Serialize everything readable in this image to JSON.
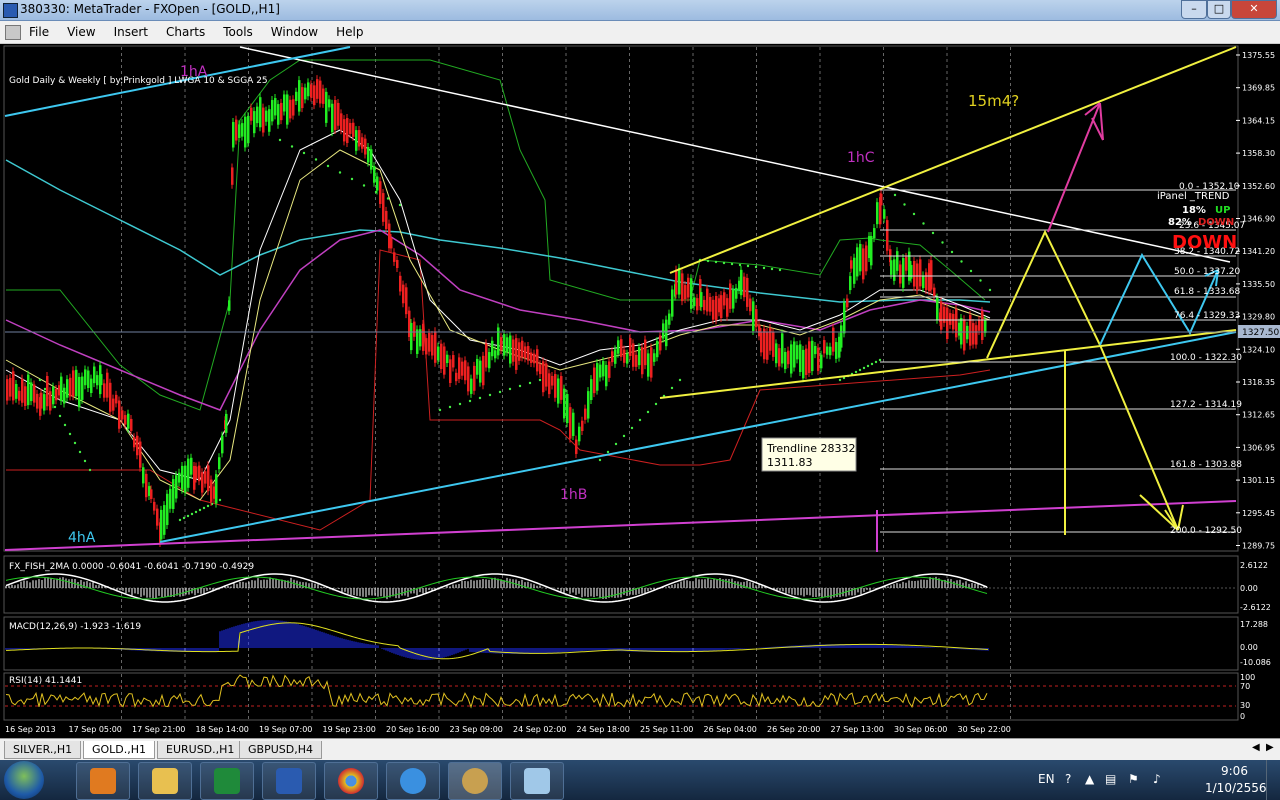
{
  "window": {
    "title": "380330: MetaTrader - FXOpen - [GOLD,,H1]"
  },
  "menu": [
    "File",
    "View",
    "Insert",
    "Charts",
    "Tools",
    "Window",
    "Help"
  ],
  "chart": {
    "header": "Gold Daily & Weekly [ by:Prinkgold ] LWGA 10  &  SGGA 25",
    "price_labels": [
      "1375.55",
      "1369.85",
      "1364.15",
      "1358.30",
      "1352.60",
      "1346.90",
      "1341.20",
      "1335.50",
      "1329.80",
      "1324.10",
      "1318.35",
      "1312.65",
      "1306.95",
      "1301.15",
      "1295.45",
      "1289.75"
    ],
    "current_price": "1327.50",
    "time_labels": [
      "16 Sep 2013",
      "17 Sep 05:00",
      "17 Sep 21:00",
      "18 Sep 14:00",
      "19 Sep 07:00",
      "19 Sep 23:00",
      "20 Sep 16:00",
      "23 Sep 09:00",
      "24 Sep 02:00",
      "24 Sep 18:00",
      "25 Sep 11:00",
      "26 Sep 04:00",
      "26 Sep 20:00",
      "27 Sep 13:00",
      "30 Sep 06:00",
      "30 Sep 22:00"
    ],
    "annotations": {
      "a1": "1hA",
      "a2": "1hB",
      "a3": "1hC",
      "a4": "4hA",
      "a5": "15m4?"
    },
    "fib_levels": [
      "0.0 - 1352.10",
      "23.6 - 1345.07",
      "38.2 - 1340.72",
      "50.0 - 1337.20",
      "61.8 - 1333.68",
      "76.4 - 1329.33",
      "100.0 - 1322.30",
      "127.2 - 1314.19",
      "161.8 - 1303.88",
      "200.0 - 1292.50"
    ],
    "ipanel": {
      "title": "iPanel _TREND",
      "pct_up": "18%",
      "up": "UP",
      "pct_down": "82%",
      "down": "DOWN",
      "big": "DOWN"
    },
    "tooltip": {
      "line1": "Trendline 28332",
      "line2": "1311.83"
    },
    "fish": {
      "label": "FX_FISH_2MA 0.0000 -0.6041 -0.6041 -0.7190 -0.4929",
      "scale_top": "2.6122",
      "scale_mid": "0.00",
      "scale_bot": "-2.6122"
    },
    "macd": {
      "label": "MACD(12,26,9) -1.923 -1.619",
      "scale_top": "17.288",
      "scale_mid": "0.00",
      "scale_bot": "-10.086"
    },
    "rsi": {
      "label": "RSI(14) 41.1441",
      "s100": "100",
      "s70": "70",
      "s30": "30",
      "s0": "0"
    }
  },
  "tabs": [
    "SILVER.,H1",
    "GOLD.,H1",
    "EURUSD.,H1",
    "GBPUSD,H4"
  ],
  "tray": {
    "lang": "EN",
    "time": "9:06",
    "date": "1/10/2556"
  }
}
